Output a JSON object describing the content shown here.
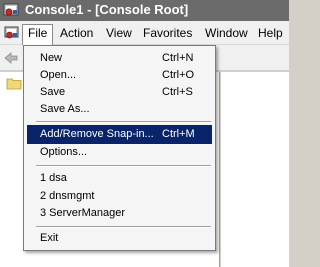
{
  "window": {
    "title": "Console1 - [Console Root]"
  },
  "menubar": {
    "items": [
      {
        "label": "File"
      },
      {
        "label": "Action"
      },
      {
        "label": "View"
      },
      {
        "label": "Favorites"
      },
      {
        "label": "Window"
      },
      {
        "label": "Help"
      }
    ]
  },
  "file_menu": {
    "items": [
      {
        "label": "New",
        "shortcut": "Ctrl+N"
      },
      {
        "label": "Open...",
        "shortcut": "Ctrl+O"
      },
      {
        "label": "Save",
        "shortcut": "Ctrl+S"
      },
      {
        "label": "Save As...",
        "shortcut": ""
      },
      {
        "label": "Add/Remove Snap-in...",
        "shortcut": "Ctrl+M"
      },
      {
        "label": "Options...",
        "shortcut": ""
      },
      {
        "label": "1 dsa",
        "shortcut": ""
      },
      {
        "label": "2 dnsmgmt",
        "shortcut": ""
      },
      {
        "label": "3 ServerManager",
        "shortcut": ""
      },
      {
        "label": "Exit",
        "shortcut": ""
      }
    ],
    "highlighted": "Add/Remove Snap-in..."
  },
  "icons": {
    "title": "mmc-console-icon",
    "menubar": "mmc-console-icon",
    "toolbar_back": "back-arrow-icon",
    "tree_root": "folder-icon"
  },
  "colors": {
    "titlebar": "#6b6b6b",
    "highlight": "#0a246a",
    "menu_bg": "#f5f5f5"
  }
}
